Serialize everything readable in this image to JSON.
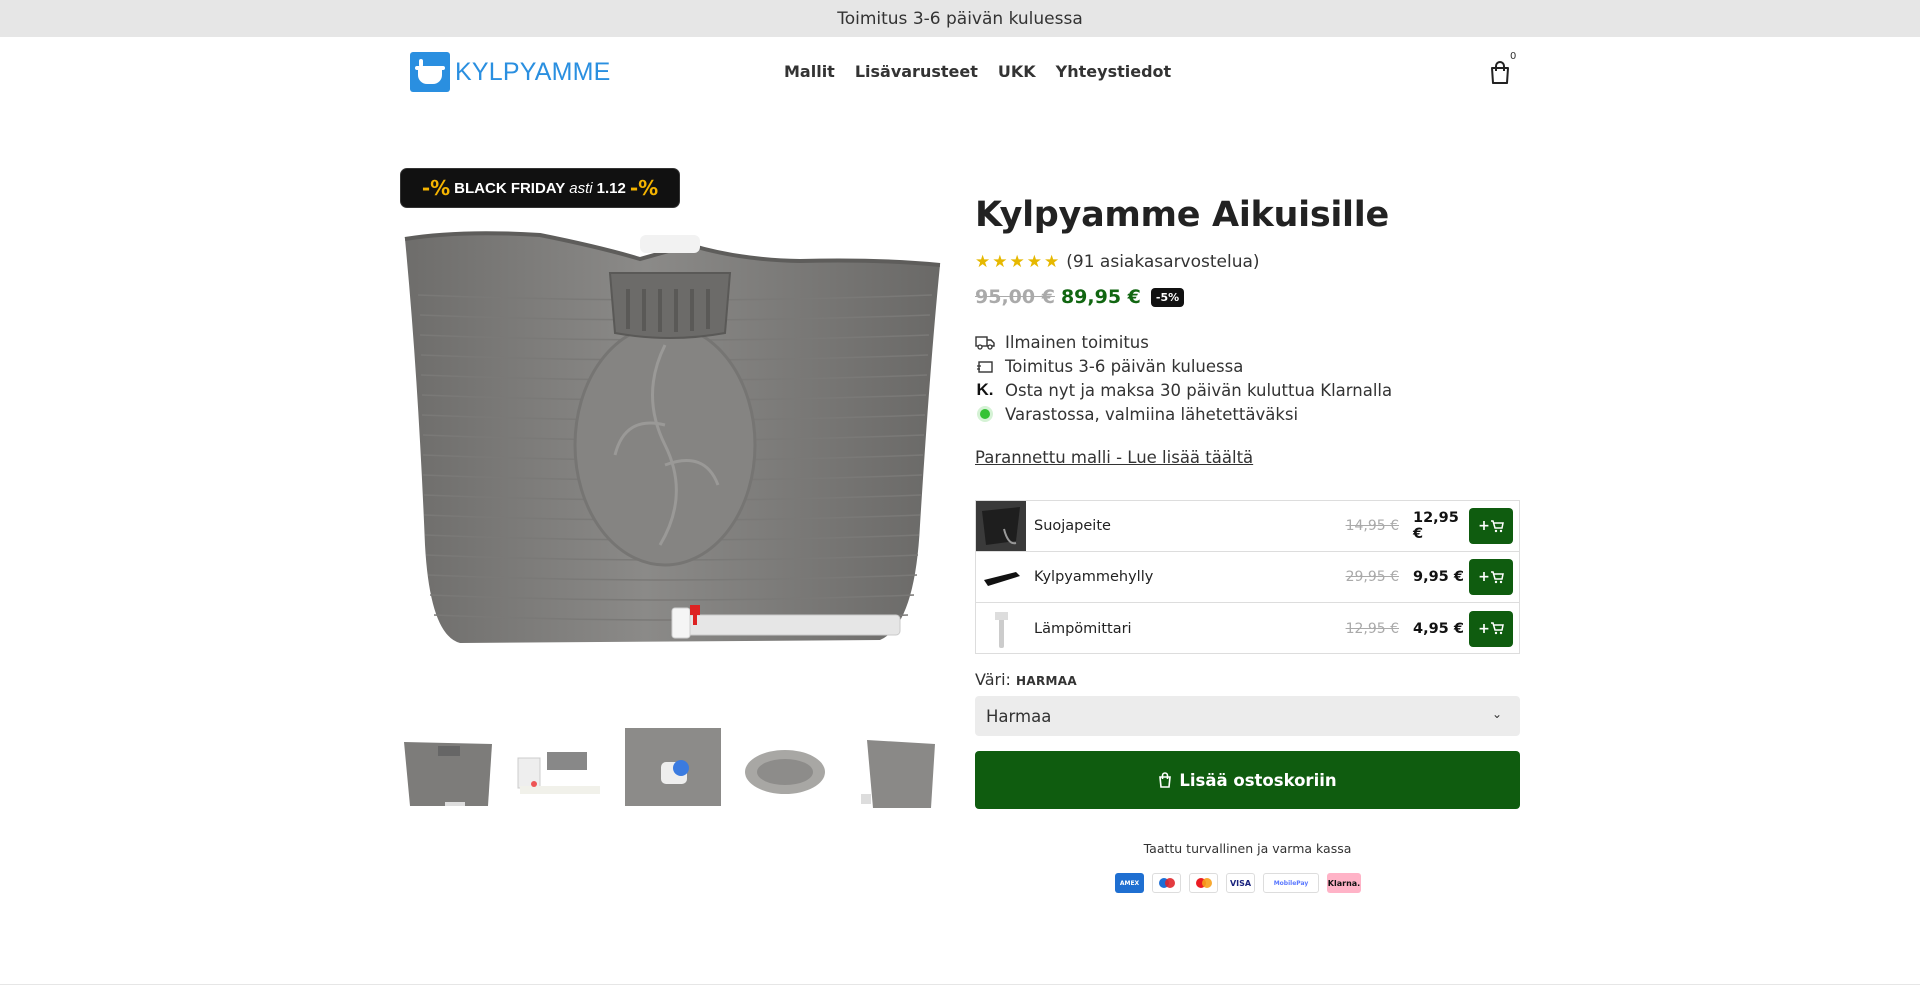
{
  "announcement": {
    "text": "Toimitus 3-6 päivän kuluessa"
  },
  "header": {
    "logo_text": "KYLPYAMME",
    "nav": [
      "Mallit",
      "Lisävarusteet",
      "UKK",
      "Yhteystiedot"
    ],
    "cart_count": "0"
  },
  "gallery": {
    "badge": {
      "pct_left": "-%",
      "label": "BLACK FRIDAY",
      "asti": "asti",
      "date": "1.12",
      "pct_right": "-%"
    },
    "thumbnails": [
      "tub-front",
      "accessories",
      "drain-closeup",
      "tub-top",
      "tub-side"
    ]
  },
  "product": {
    "title": "Kylpyamme Aikuisille",
    "rating_stars": 5,
    "rating_text": "(91 asiakasarvostelua)",
    "old_price": "95,00 €",
    "price": "89,95 €",
    "discount": "-5%",
    "features": [
      {
        "icon": "truck-icon",
        "text": "Ilmainen toimitus"
      },
      {
        "icon": "box-icon",
        "text": "Toimitus 3-6 päivän kuluessa"
      },
      {
        "icon": "klarna-icon",
        "text": "Osta nyt ja maksa 30 päivän kuluttua Klarnalla"
      },
      {
        "icon": "in-stock-icon",
        "text": "Varastossa, valmiina lähetettäväksi"
      }
    ],
    "more_link": "Parannettu malli - Lue lisää täältä",
    "upsells": [
      {
        "name": "Suojapeite",
        "old_price": "14,95 €",
        "price": "12,95 €",
        "button": "+"
      },
      {
        "name": "Kylpyammehylly",
        "old_price": "29,95 €",
        "price": "9,95 €",
        "button": "+"
      },
      {
        "name": "Lämpömittari",
        "old_price": "12,95 €",
        "price": "4,95 €",
        "button": "+"
      }
    ],
    "color_label": "Väri:",
    "color_value": "HARMAA",
    "color_selected": "Harmaa",
    "add_to_cart": "Lisää ostoskoriin",
    "secure_text": "Taattu turvallinen ja varma kassa",
    "payments": [
      "AMEX",
      "Maestro",
      "Mastercard",
      "VISA",
      "MobilePay",
      "Klarna."
    ]
  },
  "colors": {
    "brand_blue": "#2a8fe0",
    "price_green": "#116611",
    "button_green": "#0f5c0f",
    "announce_bg": "#e6e6e6",
    "star": "#e6b800"
  }
}
